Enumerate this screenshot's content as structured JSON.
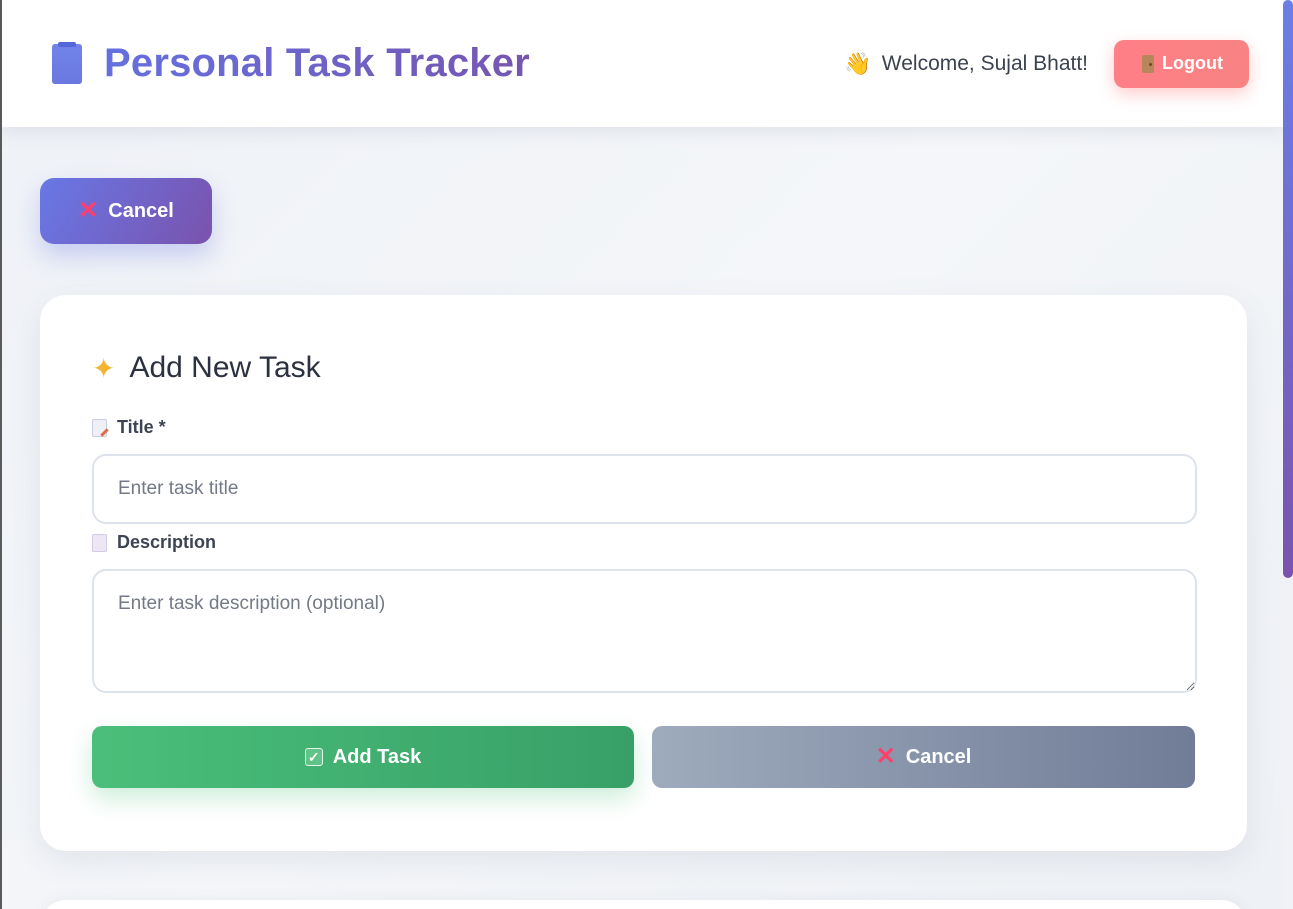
{
  "header": {
    "title": "Personal Task Tracker",
    "welcome_text": "Welcome, Sujal Bhatt!",
    "logout_label": "Logout",
    "icons": {
      "brand": "notebook-icon",
      "wave": "waving-hand-icon",
      "logout": "door-icon"
    }
  },
  "top_cancel_label": "Cancel",
  "form": {
    "heading": "Add New Task",
    "title_label": "Title *",
    "title_placeholder": "Enter task title",
    "title_value": "",
    "description_label": "Description",
    "description_placeholder": "Enter task description (optional)",
    "description_value": "",
    "add_label": "Add Task",
    "cancel_label": "Cancel"
  },
  "colors": {
    "brand_start": "#6570e0",
    "brand_end": "#7656b0",
    "logout": "#ff7f86",
    "add": "#4abf7a",
    "cancel_grey": "#9eabbd",
    "cancel_x": "#ff3e6c"
  }
}
